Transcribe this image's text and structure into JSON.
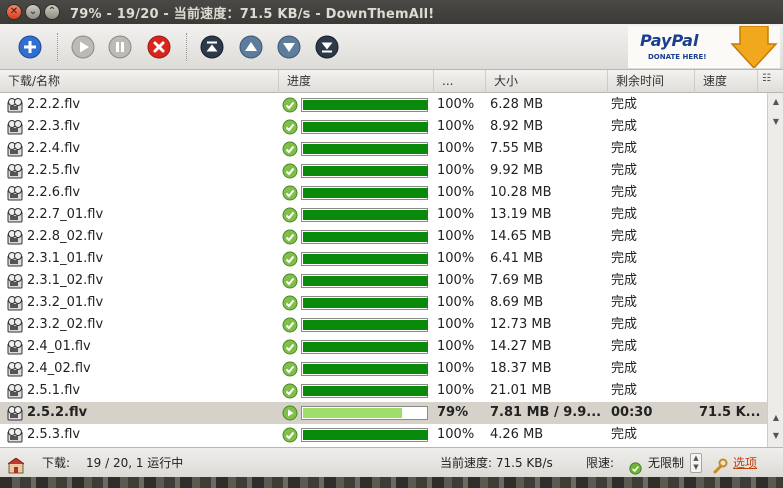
{
  "window": {
    "title": "79% - 19/20 - 当前速度：71.5 KB/s - DownThemAll!"
  },
  "paypal": {
    "logo": "PayPal",
    "subtext": "DONATE HERE!"
  },
  "columns": {
    "name": "下载/名称",
    "progress": "进度",
    "more": "...",
    "size": "大小",
    "remaining": "剩余时间",
    "speed": "速度"
  },
  "rows": [
    {
      "name": "2.2.2.flv",
      "progress": 1.0,
      "pct": "100%",
      "size": "6.28 MB",
      "remaining": "完成",
      "speed": "",
      "active": false
    },
    {
      "name": "2.2.3.flv",
      "progress": 1.0,
      "pct": "100%",
      "size": "8.92 MB",
      "remaining": "完成",
      "speed": "",
      "active": false
    },
    {
      "name": "2.2.4.flv",
      "progress": 1.0,
      "pct": "100%",
      "size": "7.55 MB",
      "remaining": "完成",
      "speed": "",
      "active": false
    },
    {
      "name": "2.2.5.flv",
      "progress": 1.0,
      "pct": "100%",
      "size": "9.92 MB",
      "remaining": "完成",
      "speed": "",
      "active": false
    },
    {
      "name": "2.2.6.flv",
      "progress": 1.0,
      "pct": "100%",
      "size": "10.28 MB",
      "remaining": "完成",
      "speed": "",
      "active": false
    },
    {
      "name": "2.2.7_01.flv",
      "progress": 1.0,
      "pct": "100%",
      "size": "13.19 MB",
      "remaining": "完成",
      "speed": "",
      "active": false
    },
    {
      "name": "2.2.8_02.flv",
      "progress": 1.0,
      "pct": "100%",
      "size": "14.65 MB",
      "remaining": "完成",
      "speed": "",
      "active": false
    },
    {
      "name": "2.3.1_01.flv",
      "progress": 1.0,
      "pct": "100%",
      "size": "6.41 MB",
      "remaining": "完成",
      "speed": "",
      "active": false
    },
    {
      "name": "2.3.1_02.flv",
      "progress": 1.0,
      "pct": "100%",
      "size": "7.69 MB",
      "remaining": "完成",
      "speed": "",
      "active": false
    },
    {
      "name": "2.3.2_01.flv",
      "progress": 1.0,
      "pct": "100%",
      "size": "8.69 MB",
      "remaining": "完成",
      "speed": "",
      "active": false
    },
    {
      "name": "2.3.2_02.flv",
      "progress": 1.0,
      "pct": "100%",
      "size": "12.73 MB",
      "remaining": "完成",
      "speed": "",
      "active": false
    },
    {
      "name": "2.4_01.flv",
      "progress": 1.0,
      "pct": "100%",
      "size": "14.27 MB",
      "remaining": "完成",
      "speed": "",
      "active": false
    },
    {
      "name": "2.4_02.flv",
      "progress": 1.0,
      "pct": "100%",
      "size": "18.37 MB",
      "remaining": "完成",
      "speed": "",
      "active": false
    },
    {
      "name": "2.5.1.flv",
      "progress": 1.0,
      "pct": "100%",
      "size": "21.01 MB",
      "remaining": "完成",
      "speed": "",
      "active": false
    },
    {
      "name": "2.5.2.flv",
      "progress": 0.79,
      "pct": "79%",
      "size": "7.81 MB / 9.9...",
      "remaining": "00:30",
      "speed": "71.5 K...",
      "active": true
    },
    {
      "name": "2.5.3.flv",
      "progress": 1.0,
      "pct": "100%",
      "size": "4.26 MB",
      "remaining": "完成",
      "speed": "",
      "active": false
    }
  ],
  "status": {
    "downloads_label": "下载:",
    "downloads_value": "19 / 20, 1 运行中",
    "speed_text": "当前速度: 71.5 KB/s",
    "limit_label": "限速:",
    "limit_value": "无限制",
    "options_label": "选项"
  },
  "colors": {
    "progress_done": "#0a8a0a",
    "progress_active": "#9fde6a",
    "active_row": "#d6d2c9"
  }
}
